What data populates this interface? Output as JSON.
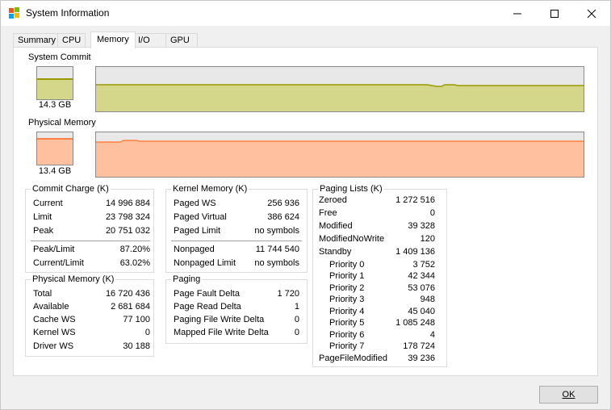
{
  "window": {
    "title": "System Information"
  },
  "tabs": [
    "Summary",
    "CPU",
    "Memory",
    "I/O",
    "GPU"
  ],
  "active_tab": "Memory",
  "system_commit": {
    "label": "System Commit",
    "value": "14.3 GB",
    "level": 0.63,
    "color": "#d4d68a",
    "line_color": "#999900"
  },
  "physical_memory_graph": {
    "label": "Physical Memory",
    "value": "13.4 GB",
    "level": 0.8,
    "color": "#ffc0a0",
    "line_color": "#ff8040"
  },
  "commit_charge": {
    "title": "Commit Charge (K)",
    "rows": [
      {
        "k": "Current",
        "v": "14 996 884"
      },
      {
        "k": "Limit",
        "v": "23 798 324"
      },
      {
        "k": "Peak",
        "v": "20 751 032"
      }
    ],
    "ratios": [
      {
        "k": "Peak/Limit",
        "v": "87.20%"
      },
      {
        "k": "Current/Limit",
        "v": "63.02%"
      }
    ]
  },
  "physical_memory": {
    "title": "Physical Memory (K)",
    "rows": [
      {
        "k": "Total",
        "v": "16 720 436"
      },
      {
        "k": "Available",
        "v": "2 681 684"
      },
      {
        "k": "Cache WS",
        "v": "77 100"
      },
      {
        "k": "Kernel WS",
        "v": "0"
      },
      {
        "k": "Driver WS",
        "v": "30 188"
      }
    ]
  },
  "kernel_memory": {
    "title": "Kernel Memory (K)",
    "rows": [
      {
        "k": "Paged WS",
        "v": "256 936"
      },
      {
        "k": "Paged Virtual",
        "v": "386 624"
      },
      {
        "k": "Paged Limit",
        "v": "no symbols"
      }
    ],
    "nonpaged": [
      {
        "k": "Nonpaged",
        "v": "11 744 540"
      },
      {
        "k": "Nonpaged Limit",
        "v": "no symbols"
      }
    ]
  },
  "paging": {
    "title": "Paging",
    "rows": [
      {
        "k": "Page Fault Delta",
        "v": "1 720"
      },
      {
        "k": "Page Read Delta",
        "v": "1"
      },
      {
        "k": "Paging File Write Delta",
        "v": "0"
      },
      {
        "k": "Mapped File Write Delta",
        "v": "0"
      }
    ]
  },
  "paging_lists": {
    "title": "Paging Lists (K)",
    "rows": [
      {
        "k": "Zeroed",
        "v": "1 272 516"
      },
      {
        "k": "Free",
        "v": "0"
      },
      {
        "k": "Modified",
        "v": "39 328"
      },
      {
        "k": "ModifiedNoWrite",
        "v": "120"
      },
      {
        "k": "Standby",
        "v": "1 409 136"
      }
    ],
    "priorities": [
      {
        "k": "Priority 0",
        "v": "3 752"
      },
      {
        "k": "Priority 1",
        "v": "42 344"
      },
      {
        "k": "Priority 2",
        "v": "53 076"
      },
      {
        "k": "Priority 3",
        "v": "948"
      },
      {
        "k": "Priority 4",
        "v": "45 040"
      },
      {
        "k": "Priority 5",
        "v": "1 085 248"
      },
      {
        "k": "Priority 6",
        "v": "4"
      },
      {
        "k": "Priority 7",
        "v": "178 724"
      }
    ],
    "footer": {
      "k": "PageFileModified",
      "v": "39 236"
    }
  },
  "ok_button": {
    "label": "OK",
    "mnemonic": "O"
  }
}
